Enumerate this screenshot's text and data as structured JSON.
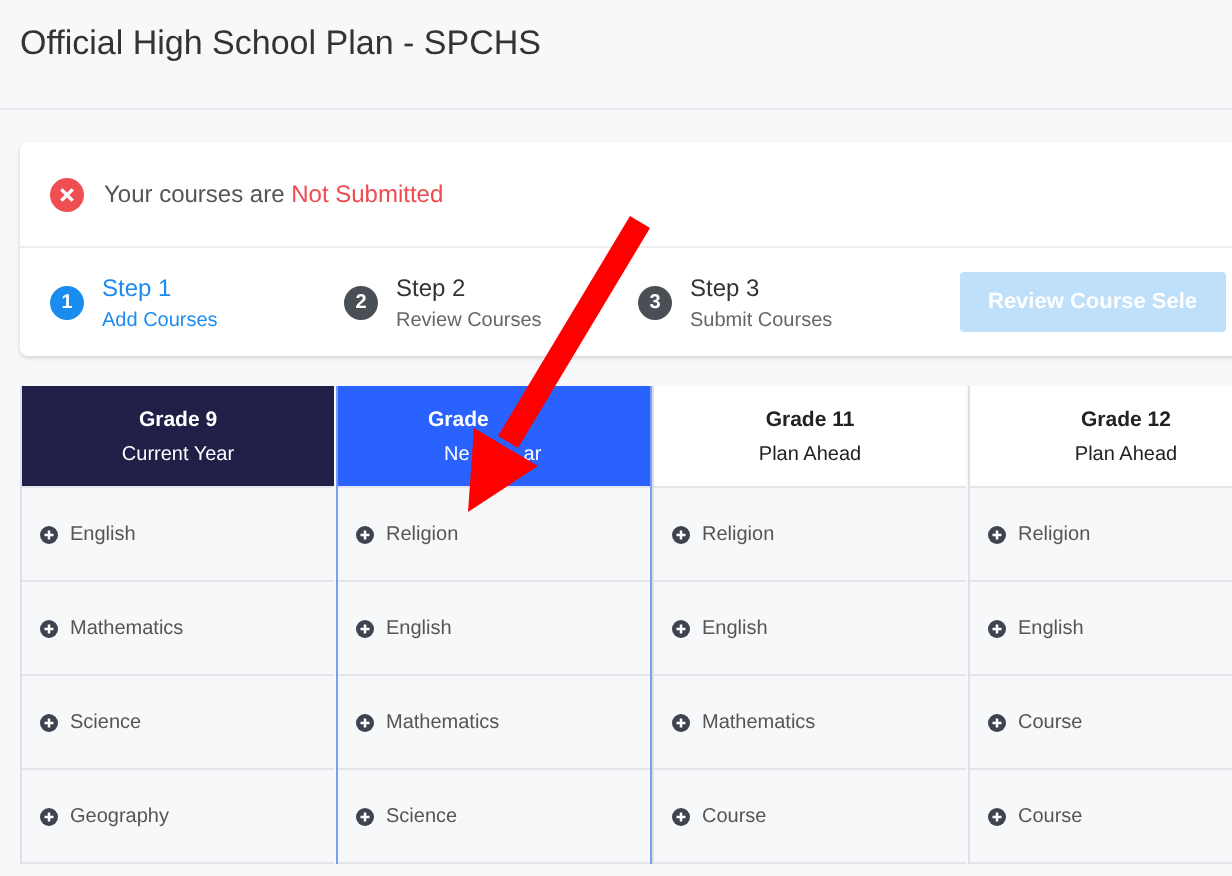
{
  "page": {
    "title": "Official High School Plan - SPCHS"
  },
  "status": {
    "text": "Your courses are ",
    "state": "Not Submitted"
  },
  "steps": [
    {
      "number": "1",
      "title": "Step 1",
      "subtitle": "Add Courses",
      "selected": true
    },
    {
      "number": "2",
      "title": "Step 2",
      "subtitle": "Review Courses",
      "selected": false
    },
    {
      "number": "3",
      "title": "Step 3",
      "subtitle": "Submit Courses",
      "selected": false
    }
  ],
  "review_button": {
    "label": "Review Course Sele",
    "disabled": true
  },
  "grades": [
    {
      "name": [
        "Grade 9"
      ],
      "period": [
        "Current Year"
      ],
      "kind": "current",
      "selected": false,
      "covered": false,
      "courses": [
        "English",
        "Mathematics",
        "Science",
        "Geography"
      ]
    },
    {
      "name": [
        "Grade"
      ],
      "period": [
        "Ne",
        "ar"
      ],
      "kind": "next",
      "selected": true,
      "covered": true,
      "courses": [
        "Religion",
        "English",
        "Mathematics",
        "Science"
      ]
    },
    {
      "name": [
        "Grade 11"
      ],
      "period": [
        "Plan Ahead"
      ],
      "kind": "ahead",
      "selected": false,
      "covered": false,
      "courses": [
        "Religion",
        "English",
        "Mathematics",
        "Course"
      ]
    },
    {
      "name": [
        "Grade 12"
      ],
      "period": [
        "Plan Ahead"
      ],
      "kind": "ahead",
      "selected": false,
      "covered": false,
      "courses": [
        "Religion",
        "English",
        "Course",
        "Course"
      ]
    }
  ]
}
